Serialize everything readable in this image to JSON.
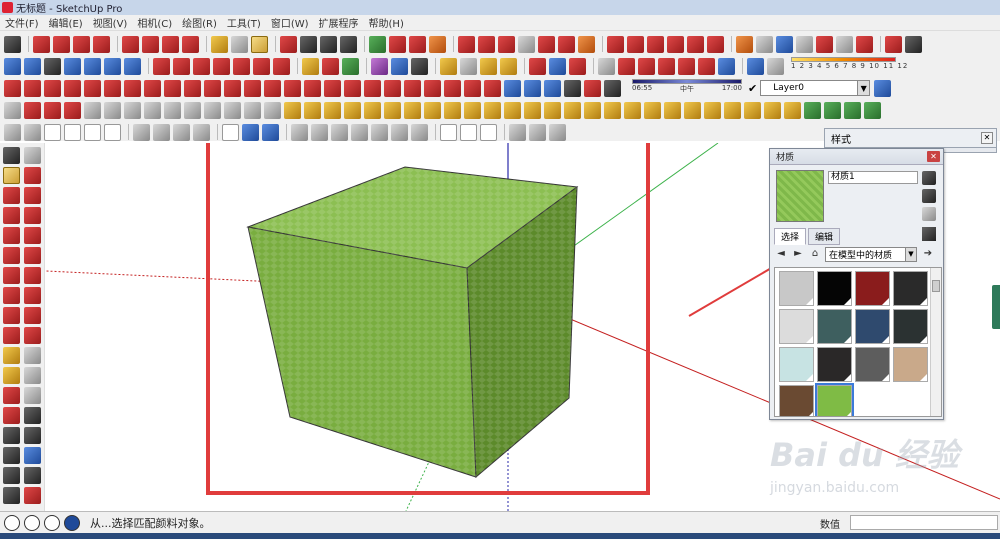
{
  "window": {
    "title": "无标题 - SketchUp Pro"
  },
  "menu": [
    {
      "label": "文件(F)"
    },
    {
      "label": "编辑(E)"
    },
    {
      "label": "视图(V)"
    },
    {
      "label": "相机(C)"
    },
    {
      "label": "绘图(R)"
    },
    {
      "label": "工具(T)"
    },
    {
      "label": "窗口(W)"
    },
    {
      "label": "扩展程序"
    },
    {
      "label": "帮助(H)"
    }
  ],
  "toolbar": {
    "shadow_ticks": "1 2 3 4 5 6 7 8 9 10 11 12",
    "time_start": "06:55",
    "time_mid": "中午",
    "time_end": "17:00",
    "layer_value": "Layer0"
  },
  "style_panel": {
    "title": "样式"
  },
  "materials": {
    "title": "材质",
    "material_name": "材质1",
    "tab_select": "选择",
    "tab_edit": "编辑",
    "collection": "在模型中的材质",
    "swatches": [
      {
        "color": "#c8c8c8"
      },
      {
        "color": "#050505"
      },
      {
        "color": "#8a1c1c"
      },
      {
        "color": "#2a2a2a"
      },
      {
        "color": "#dcdcdc"
      },
      {
        "color": "#3e5f5f"
      },
      {
        "color": "#2f4a6e"
      },
      {
        "color": "#2b3232"
      },
      {
        "color": "#c7e3e3"
      },
      {
        "color": "#2a2828"
      },
      {
        "color": "#5d5d5d"
      },
      {
        "color": "#c9a98a"
      },
      {
        "color": "#6a4a32"
      },
      {
        "color": "#7fbb45"
      }
    ]
  },
  "status": {
    "message": "从...选择匹配颜料对象。",
    "measure_label": "数值",
    "measure_value": ""
  },
  "watermark": {
    "main": "Bai du 经验",
    "sub": "jingyan.baidu.com"
  },
  "colors": {
    "highlight_red": "#e03c3c",
    "cube_top": "#8cbf52",
    "cube_left": "#79ad3f",
    "cube_right": "#5c8a2a"
  }
}
